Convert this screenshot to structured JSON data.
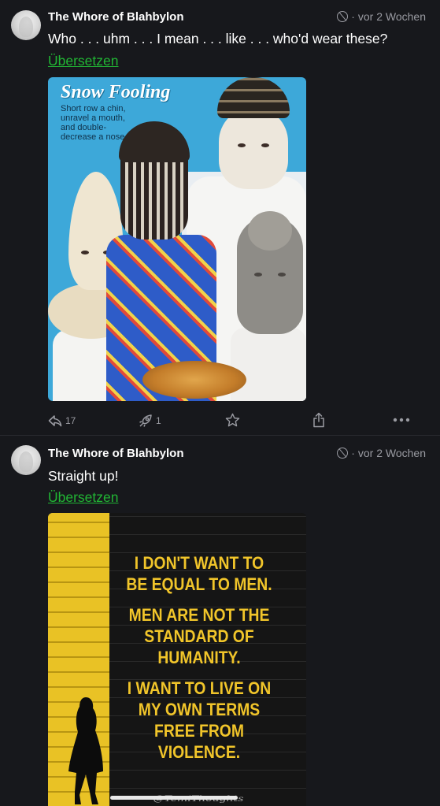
{
  "posts": [
    {
      "author": "The Whore of Blahbylon",
      "time": "vor 2 Wochen",
      "text": "Who . . . uhm . . . I mean . . . like . . . who'd wear these?",
      "translate_label": "Übersetzen",
      "image": {
        "title": "Snow Fooling",
        "subtitle": "Short row a chin, unravel a mouth, and double-decrease a nose"
      },
      "actions": {
        "reply_count": "17",
        "boost_count": "1"
      }
    },
    {
      "author": "The Whore of Blahbylon",
      "time": "vor 2 Wochen",
      "text": "Straight up!",
      "translate_label": "Übersetzen",
      "image": {
        "lines": [
          "I DON'T WANT TO BE EQUAL TO MEN.",
          "MEN ARE NOT THE STANDARD OF HUMANITY.",
          "I WANT TO LIVE ON MY OWN TERMS FREE FROM VIOLENCE."
        ],
        "handle": "@TemiThoughts"
      }
    }
  ],
  "icons": {
    "visibility": "globe-icon",
    "reply": "reply-icon",
    "boost": "boost-icon",
    "favourite": "star-icon",
    "share": "share-icon",
    "more": "more-icon"
  },
  "colors": {
    "background": "#17181c",
    "translate_link": "#21b534",
    "muted": "#9a9ba2"
  }
}
